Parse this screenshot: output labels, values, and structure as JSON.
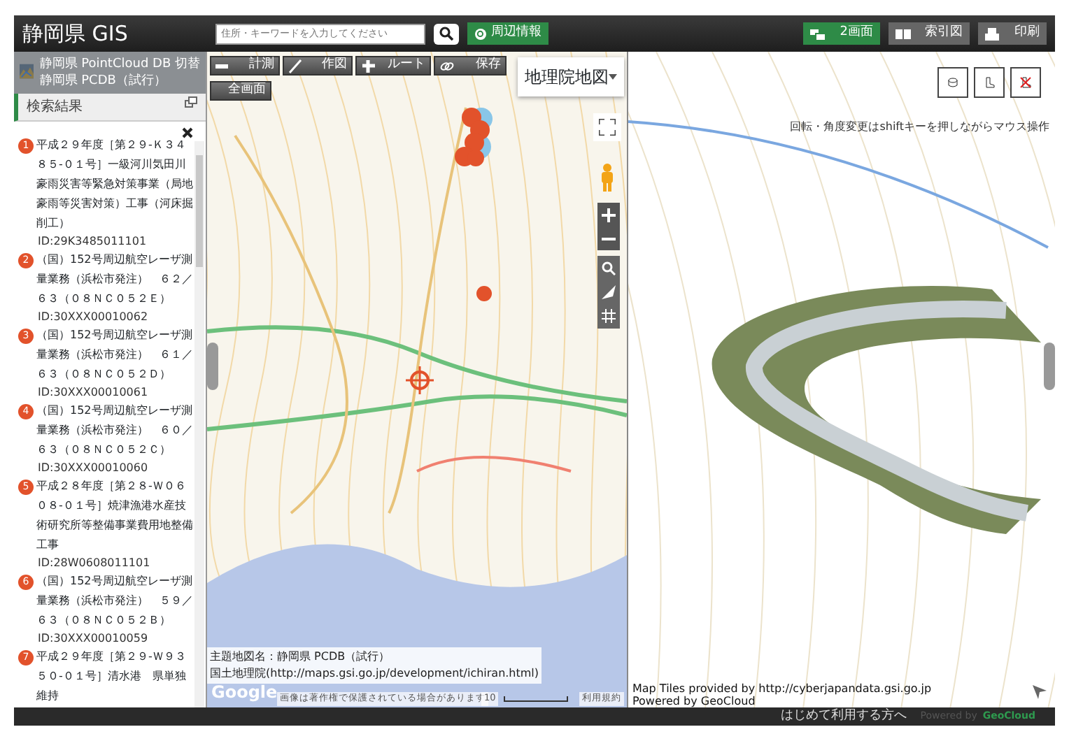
{
  "header": {
    "title": "静岡県 GIS",
    "search": {
      "placeholder": "住所・キーワードを入力してください"
    },
    "nearby_button": "周辺情報",
    "buttons": [
      {
        "label": "2画面",
        "selected": true
      },
      {
        "label": "索引図",
        "selected": false
      },
      {
        "label": "印刷",
        "selected": false
      }
    ]
  },
  "layer": {
    "title": "静岡県 PointCloud DB",
    "switch": "切替",
    "subtitle": "静岡県 PCDB（試行）"
  },
  "results": {
    "title": "検索結果",
    "items": [
      {
        "number": "1",
        "title": "平成２９年度［第２９-Ｋ３４８５-０１号］一級河川気田川豪雨災害等緊急対策事業（局地豪雨等災害対策）工事（河床掘削工）",
        "id": "ID:29K3485011101"
      },
      {
        "number": "2",
        "title": "（国）152号周辺航空レーザ測量業務（浜松市発注）　６２／６３（０８ＮＣ０５２Ｅ）",
        "id": "ID:30XXX00010062"
      },
      {
        "number": "3",
        "title": "（国）152号周辺航空レーザ測量業務（浜松市発注）　６１／６３（０８ＮＣ０５２Ｄ）",
        "id": "ID:30XXX00010061"
      },
      {
        "number": "4",
        "title": "（国）152号周辺航空レーザ測量業務（浜松市発注）　６０／６３（０８ＮＣ０５２Ｃ）",
        "id": "ID:30XXX00010060"
      },
      {
        "number": "5",
        "title": "平成２８年度［第２８-Ｗ０６０８-０１号］焼津漁港水産技術研究所等整備事業費用地整備工事",
        "id": "ID:28W0608011101"
      },
      {
        "number": "6",
        "title": "（国）152号周辺航空レーザ測量業務（浜松市発注）　５９／６３（０８ＮＣ０５２Ｂ）",
        "id": "ID:30XXX00010059"
      },
      {
        "number": "7",
        "title": "平成２９年度［第２９-Ｗ９３５０-０１号］清水港　県単独維持"
      }
    ]
  },
  "map": {
    "tools": [
      {
        "label": "計測",
        "kind": "ruler"
      },
      {
        "label": "作図",
        "kind": "pencil"
      },
      {
        "label": "ルート",
        "kind": "route"
      },
      {
        "label": "保存",
        "kind": "link"
      }
    ],
    "fullscreen_button": "全画面",
    "basemap": "地理院地図",
    "legend": [
      "主題地図名：静岡県 PCDB（試行）",
      "国土地理院(http://maps.gsi.go.jp/development/ichiran.html)"
    ],
    "google": "Google",
    "copyright": "画像は著作権で保護されている場合があります",
    "scale": "10",
    "terms": "利用規約"
  },
  "viewer": {
    "hint": "回転・角度変更はshiftキーを押しながらマウス操作",
    "attribution": [
      "Map Tiles provided by http://cyberjapandata.gsi.go.jp",
      "Powered by GeoCloud"
    ]
  },
  "footer": {
    "link": "はじめて利用する方へ",
    "powered": "Powered by",
    "brand": "GeoCloud"
  }
}
